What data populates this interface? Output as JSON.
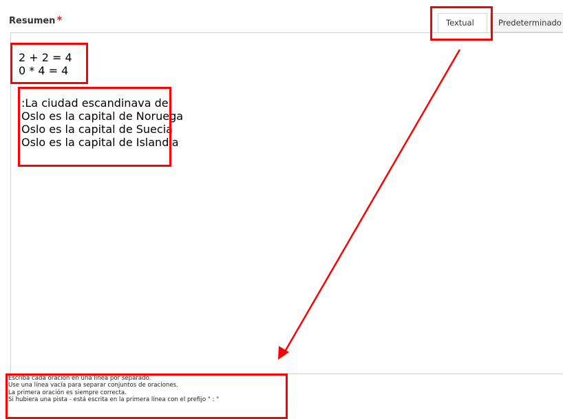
{
  "field": {
    "label": "Resumen",
    "required_mark": "*"
  },
  "tabs": [
    {
      "label": "Textual",
      "active": true
    },
    {
      "label": "Predeterminado",
      "active": false
    }
  ],
  "editor": {
    "lines_a": [
      "2 + 2 = 4",
      "0 * 4 = 4"
    ],
    "lines_b": [
      ":La ciudad escandinava de",
      "Oslo es la capital de Noruega",
      "Oslo es la capital de Suecia",
      "Oslo es la capital de Islandia"
    ]
  },
  "help": [
    "Escriba cada oración en una línea por separado.",
    "Use una línea vacía para separar conjuntos de oraciones.",
    "La primera oración es siempre correcta.",
    "Si hubiera una pista - está escrita en la primera línea con el prefijo \" : \""
  ],
  "colors": {
    "highlight": "#ff0000",
    "required": "#e02020"
  }
}
